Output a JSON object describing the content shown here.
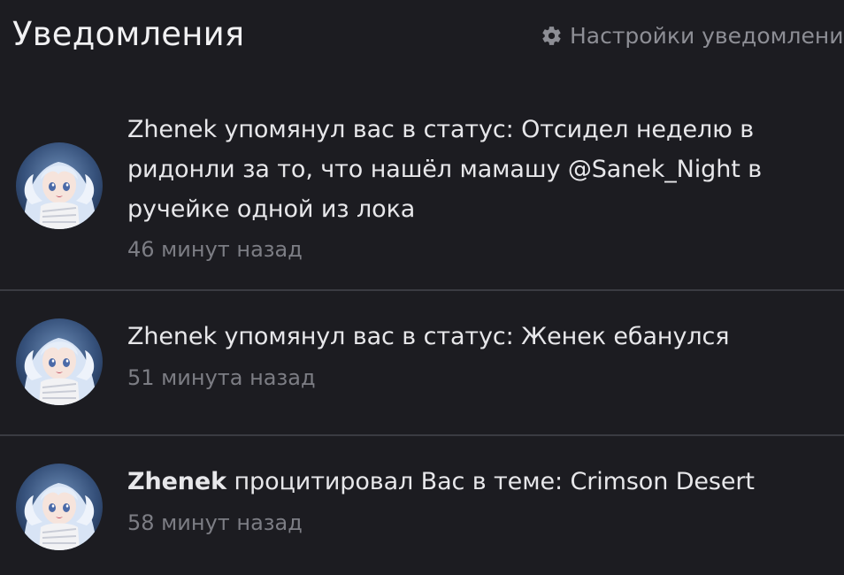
{
  "header": {
    "title": "Уведомления",
    "settings_label": "Настройки уведомлени",
    "settings_icon": "gear-icon"
  },
  "notifications": [
    {
      "user": "Zhenek",
      "action": " упомянул вас в статус: ",
      "content": "Отсидел неделю в ридонли за то, что нашёл мамашу @Sanek_Night в ручейке одной из лока",
      "time": "46 минут назад"
    },
    {
      "user": "Zhenek",
      "action": " упомянул вас в статус: ",
      "content": "Женек ебанулся",
      "time": "51 минута назад"
    },
    {
      "user": "Zhenek",
      "action": " процитировал Вас в теме: ",
      "content": "Crimson Desert",
      "time": "58 минут назад"
    }
  ],
  "colors": {
    "background": "#1c1c21",
    "text": "#e7e7ea",
    "muted": "#7c7d84",
    "divider": "#3a3b42"
  }
}
